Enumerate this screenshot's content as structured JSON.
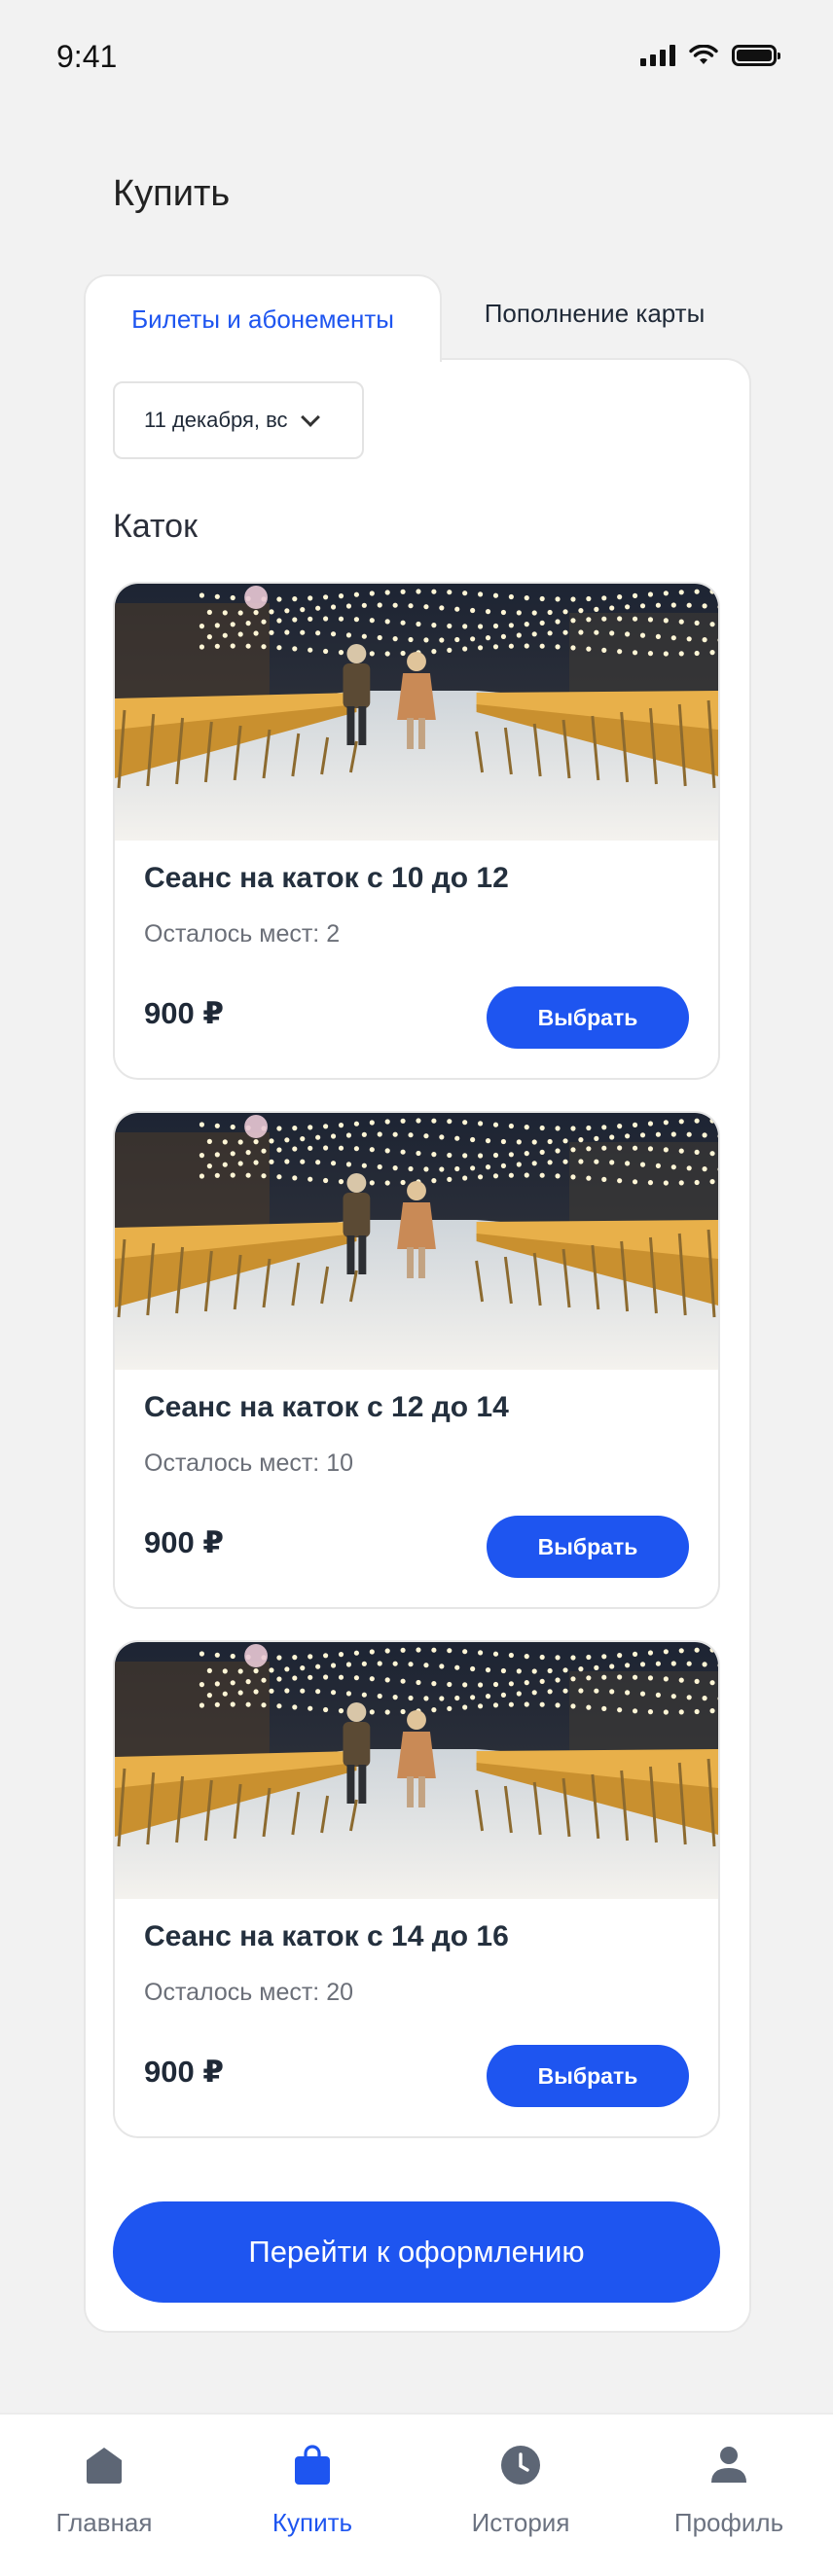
{
  "status_bar": {
    "time": "9:41"
  },
  "page": {
    "title": "Купить"
  },
  "tabs": [
    {
      "label": "Билеты и абонементы",
      "active": true
    },
    {
      "label": "Пополнение карты",
      "active": false
    }
  ],
  "date_filter": {
    "value": "11 декабря, вс"
  },
  "section": {
    "title": "Каток"
  },
  "sessions": [
    {
      "title": "Сеанс на каток с 10 до 12",
      "seats": "Осталось мест: 2",
      "price": "900 ₽",
      "button": "Выбрать"
    },
    {
      "title": "Сеанс на каток с 12 до 14",
      "seats": "Осталось мест: 10",
      "price": "900 ₽",
      "button": "Выбрать"
    },
    {
      "title": "Сеанс на каток с 14 до 16",
      "seats": "Осталось мест: 20",
      "price": "900 ₽",
      "button": "Выбрать"
    }
  ],
  "checkout": {
    "label": "Перейти к оформлению"
  },
  "bottom_nav": [
    {
      "label": "Главная",
      "icon": "home-icon",
      "active": false
    },
    {
      "label": "Купить",
      "icon": "shopping-bag-icon",
      "active": true
    },
    {
      "label": "История",
      "icon": "clock-icon",
      "active": false
    },
    {
      "label": "Профиль",
      "icon": "user-icon",
      "active": false
    }
  ],
  "colors": {
    "accent": "#1e55f0",
    "background": "#f2f2f2",
    "nav_inactive": "#6b7280"
  }
}
